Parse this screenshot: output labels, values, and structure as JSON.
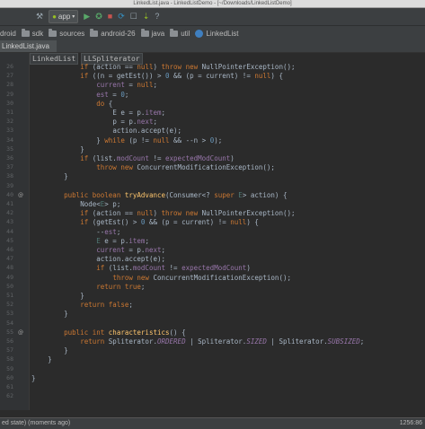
{
  "window": {
    "title": "LinkedList.java - LinkedListDemo - [~/Downloads/LinkedListDemo]"
  },
  "toolbar": {
    "run_config": "app",
    "icons": [
      "hammer-icon",
      "run-icon",
      "debug-icon",
      "stop-icon",
      "sync-icon",
      "avd-icon",
      "sdk-icon",
      "help-icon"
    ]
  },
  "breadcrumb_nav": [
    "droid",
    "sdk",
    "sources",
    "android-26",
    "java",
    "util",
    "LinkedList"
  ],
  "file_tab": "LinkedList.java",
  "structure_breadcrumbs": [
    "LinkedList",
    "LLSpliterator"
  ],
  "code_lines": [
    {
      "no": "26",
      "indent": "            ",
      "code": [
        [
          "k",
          "if"
        ],
        [
          "t",
          " (action == "
        ],
        [
          "k",
          "null"
        ],
        [
          "t",
          ") "
        ],
        [
          "k",
          "throw new "
        ],
        [
          "t",
          "NullPointerException();"
        ]
      ]
    },
    {
      "no": "27",
      "indent": "            ",
      "code": [
        [
          "k",
          "if"
        ],
        [
          "t",
          " ((n = getEst()) > "
        ],
        [
          "n",
          "0"
        ],
        [
          "t",
          " && (p = current) != "
        ],
        [
          "k",
          "null"
        ],
        [
          "t",
          ") {"
        ]
      ]
    },
    {
      "no": "28",
      "indent": "                ",
      "code": [
        [
          "f",
          "current"
        ],
        [
          "t",
          " = "
        ],
        [
          "k",
          "null"
        ],
        [
          "t",
          ";"
        ]
      ]
    },
    {
      "no": "29",
      "indent": "                ",
      "code": [
        [
          "f",
          "est"
        ],
        [
          "t",
          " = "
        ],
        [
          "n",
          "0"
        ],
        [
          "t",
          ";"
        ]
      ]
    },
    {
      "no": "30",
      "indent": "                ",
      "code": [
        [
          "k",
          "do"
        ],
        [
          "t",
          " {"
        ]
      ]
    },
    {
      "no": "31",
      "indent": "                    ",
      "code": [
        [
          "t",
          "E e = p."
        ],
        [
          "f",
          "item"
        ],
        [
          "t",
          ";"
        ]
      ]
    },
    {
      "no": "32",
      "indent": "                    ",
      "code": [
        [
          "t",
          "p = p."
        ],
        [
          "f",
          "next"
        ],
        [
          "t",
          ";"
        ]
      ]
    },
    {
      "no": "33",
      "indent": "                    ",
      "code": [
        [
          "t",
          "action.accept(e);"
        ]
      ]
    },
    {
      "no": "34",
      "indent": "                ",
      "code": [
        [
          "t",
          "} "
        ],
        [
          "k",
          "while"
        ],
        [
          "t",
          " (p != "
        ],
        [
          "k",
          "null"
        ],
        [
          "t",
          " && --n > "
        ],
        [
          "n",
          "0"
        ],
        [
          "t",
          ");"
        ]
      ]
    },
    {
      "no": "35",
      "indent": "            ",
      "code": [
        [
          "t",
          "}"
        ]
      ]
    },
    {
      "no": "36",
      "indent": "            ",
      "code": [
        [
          "k",
          "if"
        ],
        [
          "t",
          " (list."
        ],
        [
          "f",
          "modCount"
        ],
        [
          "t",
          " != "
        ],
        [
          "f",
          "expectedModCount"
        ],
        [
          "t",
          ")"
        ]
      ]
    },
    {
      "no": "37",
      "indent": "                ",
      "code": [
        [
          "k",
          "throw new "
        ],
        [
          "t",
          "ConcurrentModificationException();"
        ]
      ]
    },
    {
      "no": "38",
      "indent": "        ",
      "code": [
        [
          "t",
          "}"
        ]
      ]
    },
    {
      "no": "39",
      "indent": "",
      "code": []
    },
    {
      "no": "40",
      "indent": "        ",
      "code": [
        [
          "k",
          "public boolean "
        ],
        [
          "m",
          "tryAdvance"
        ],
        [
          "t",
          "(Consumer<? "
        ],
        [
          "k",
          "super "
        ],
        [
          "g",
          "E"
        ],
        [
          "t",
          "> action) {"
        ]
      ]
    },
    {
      "no": "41",
      "indent": "            ",
      "code": [
        [
          "t",
          "Node<"
        ],
        [
          "g",
          "E"
        ],
        [
          "t",
          "> p;"
        ]
      ]
    },
    {
      "no": "42",
      "indent": "            ",
      "code": [
        [
          "k",
          "if"
        ],
        [
          "t",
          " (action == "
        ],
        [
          "k",
          "null"
        ],
        [
          "t",
          ") "
        ],
        [
          "k",
          "throw new "
        ],
        [
          "t",
          "NullPointerException();"
        ]
      ]
    },
    {
      "no": "43",
      "indent": "            ",
      "code": [
        [
          "k",
          "if"
        ],
        [
          "t",
          " (getEst() > "
        ],
        [
          "n",
          "0"
        ],
        [
          "t",
          " && (p = current) != "
        ],
        [
          "k",
          "null"
        ],
        [
          "t",
          ") {"
        ]
      ]
    },
    {
      "no": "44",
      "indent": "                ",
      "code": [
        [
          "t",
          "--"
        ],
        [
          "f",
          "est"
        ],
        [
          "t",
          ";"
        ]
      ]
    },
    {
      "no": "45",
      "indent": "                ",
      "code": [
        [
          "g",
          "E"
        ],
        [
          "t",
          " e = p."
        ],
        [
          "f",
          "item"
        ],
        [
          "t",
          ";"
        ]
      ]
    },
    {
      "no": "46",
      "indent": "                ",
      "code": [
        [
          "f",
          "current"
        ],
        [
          "t",
          " = p."
        ],
        [
          "f",
          "next"
        ],
        [
          "t",
          ";"
        ]
      ]
    },
    {
      "no": "47",
      "indent": "                ",
      "code": [
        [
          "t",
          "action.accept(e);"
        ]
      ]
    },
    {
      "no": "48",
      "indent": "                ",
      "code": [
        [
          "k",
          "if"
        ],
        [
          "t",
          " (list."
        ],
        [
          "f",
          "modCount"
        ],
        [
          "t",
          " != "
        ],
        [
          "f",
          "expectedModCount"
        ],
        [
          "t",
          ")"
        ]
      ]
    },
    {
      "no": "49",
      "indent": "                    ",
      "code": [
        [
          "k",
          "throw new "
        ],
        [
          "t",
          "ConcurrentModificationException();"
        ]
      ]
    },
    {
      "no": "50",
      "indent": "                ",
      "code": [
        [
          "k",
          "return true"
        ],
        [
          "t",
          ";"
        ]
      ]
    },
    {
      "no": "51",
      "indent": "            ",
      "code": [
        [
          "t",
          "}"
        ]
      ]
    },
    {
      "no": "52",
      "indent": "            ",
      "code": [
        [
          "k",
          "return false"
        ],
        [
          "t",
          ";"
        ]
      ]
    },
    {
      "no": "53",
      "indent": "        ",
      "code": [
        [
          "t",
          "}"
        ]
      ]
    },
    {
      "no": "54",
      "indent": "",
      "code": []
    },
    {
      "no": "55",
      "indent": "        ",
      "code": [
        [
          "k",
          "public int "
        ],
        [
          "m",
          "characteristics"
        ],
        [
          "t",
          "() {"
        ]
      ]
    },
    {
      "no": "56",
      "indent": "            ",
      "code": [
        [
          "k",
          "return "
        ],
        [
          "t",
          "Spliterator."
        ],
        [
          "s",
          "ORDERED"
        ],
        [
          "t",
          " | Spliterator."
        ],
        [
          "s",
          "SIZED"
        ],
        [
          "t",
          " | Spliterator."
        ],
        [
          "s",
          "SUBSIZED"
        ],
        [
          "t",
          ";"
        ]
      ]
    },
    {
      "no": "57",
      "indent": "        ",
      "code": [
        [
          "t",
          "}"
        ]
      ]
    },
    {
      "no": "58",
      "indent": "    ",
      "code": [
        [
          "t",
          "}"
        ]
      ]
    },
    {
      "no": "59",
      "indent": "",
      "code": []
    },
    {
      "no": "60",
      "indent": "",
      "code": [
        [
          "t",
          "}"
        ]
      ]
    },
    {
      "no": "61",
      "indent": "",
      "code": []
    },
    {
      "no": "62",
      "indent": "",
      "code": []
    }
  ],
  "status": {
    "message": "ed state) (moments ago)",
    "position": "1256:86"
  }
}
